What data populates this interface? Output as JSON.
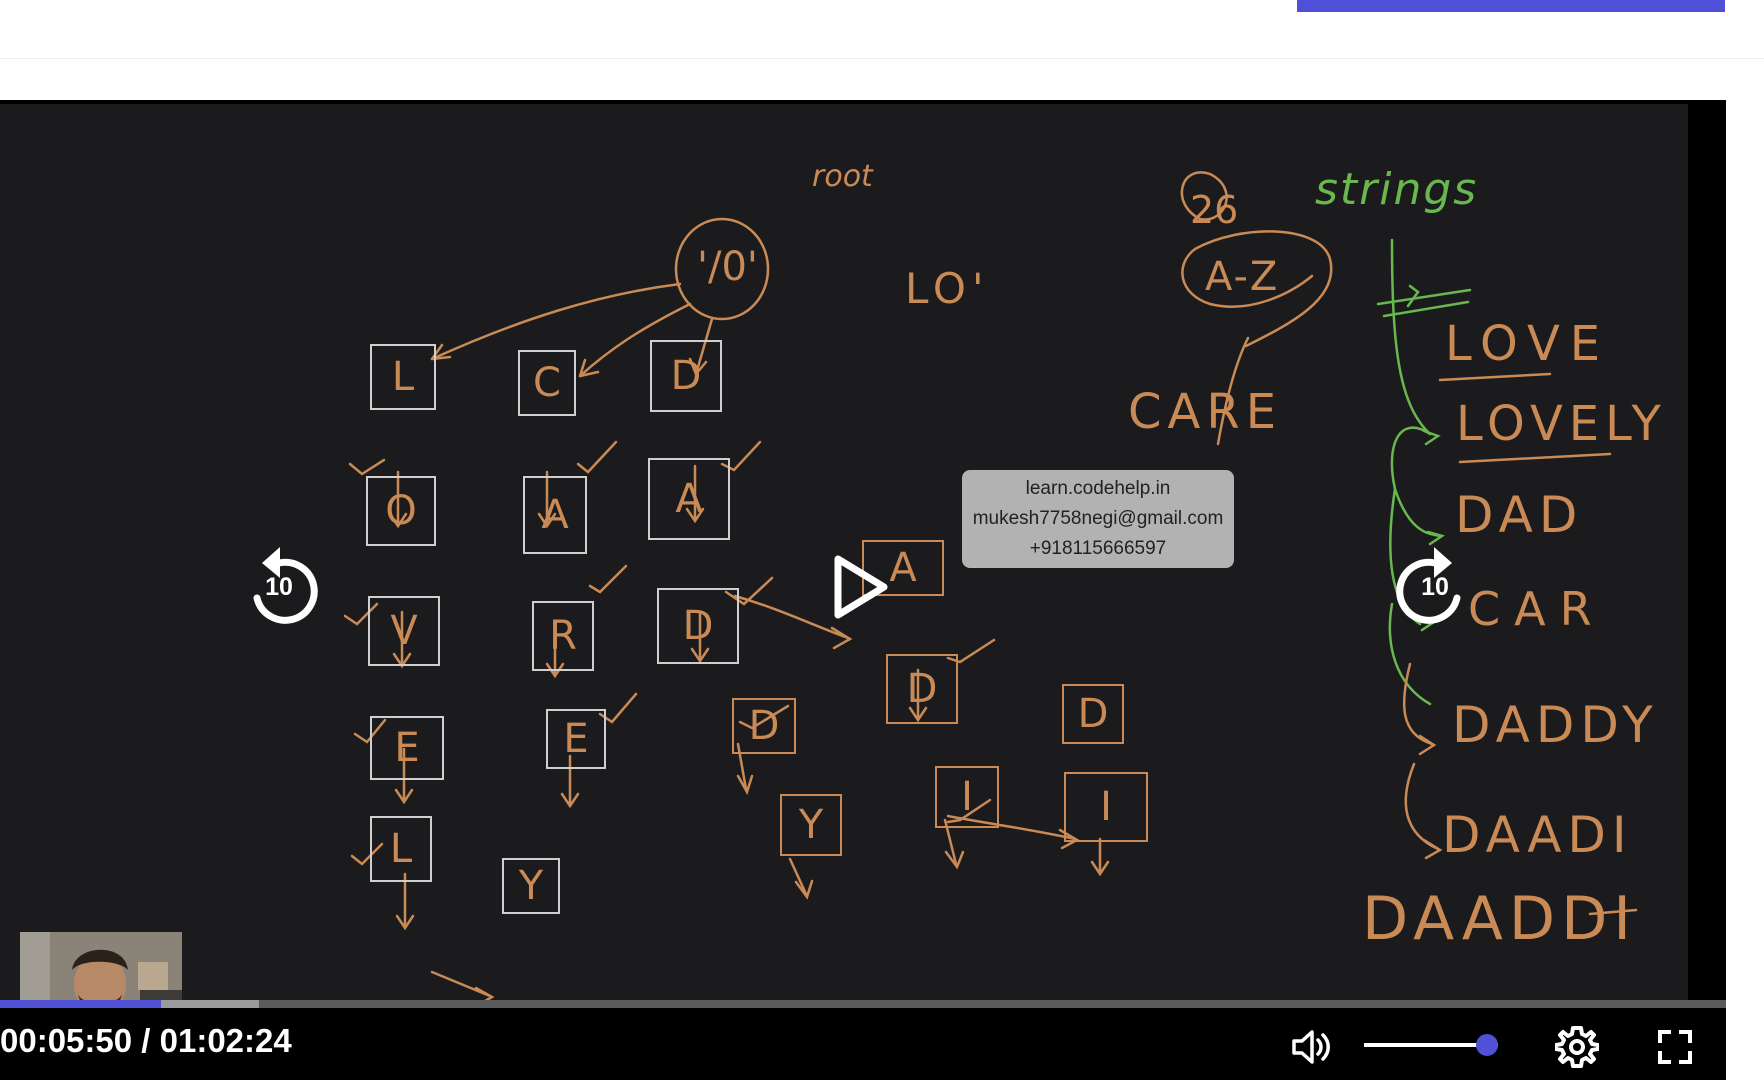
{
  "colors": {
    "accent": "#5151d6",
    "board_background": "#1b1b1d",
    "chalk_orange": "#c98a55",
    "chalk_green": "#69b84f",
    "box_outline": "#cfcfcf",
    "watermark_background": "#b2b2b2"
  },
  "board": {
    "root_label": "'/0'",
    "root_note": "root",
    "partial_word": "LO'",
    "heading": "strings",
    "count_note": "26",
    "range_note": "A-Z",
    "extra_word": "CARE",
    "word_list": [
      "LOVE",
      "LOVELY",
      "DAD",
      "CAR",
      "DADDY",
      "DAADI",
      "DAADDI"
    ],
    "trie_nodes": [
      "L",
      "O",
      "V",
      "E",
      "L",
      "Y",
      "C",
      "A",
      "R",
      "E",
      "D",
      "A",
      "D",
      "D",
      "Y",
      "A",
      "D",
      "I",
      "D",
      "I"
    ]
  },
  "watermark": {
    "lines": [
      "learn.codehelp.in",
      "mukesh7758negi@gmail.com",
      "+918115666597"
    ]
  },
  "player": {
    "skip_back_seconds": "10",
    "skip_forward_seconds": "10",
    "current_time": "00:05:50",
    "duration": "01:02:24",
    "time_separator": " / ",
    "progress_played_fraction": 0.093,
    "progress_buffered_fraction": 0.15,
    "volume_fraction": 0.92,
    "icons": {
      "play": "play-icon",
      "skip_back": "rewind-10-icon",
      "skip_forward": "forward-10-icon",
      "volume": "volume-icon",
      "settings": "gear-icon",
      "fullscreen": "fullscreen-icon"
    }
  }
}
